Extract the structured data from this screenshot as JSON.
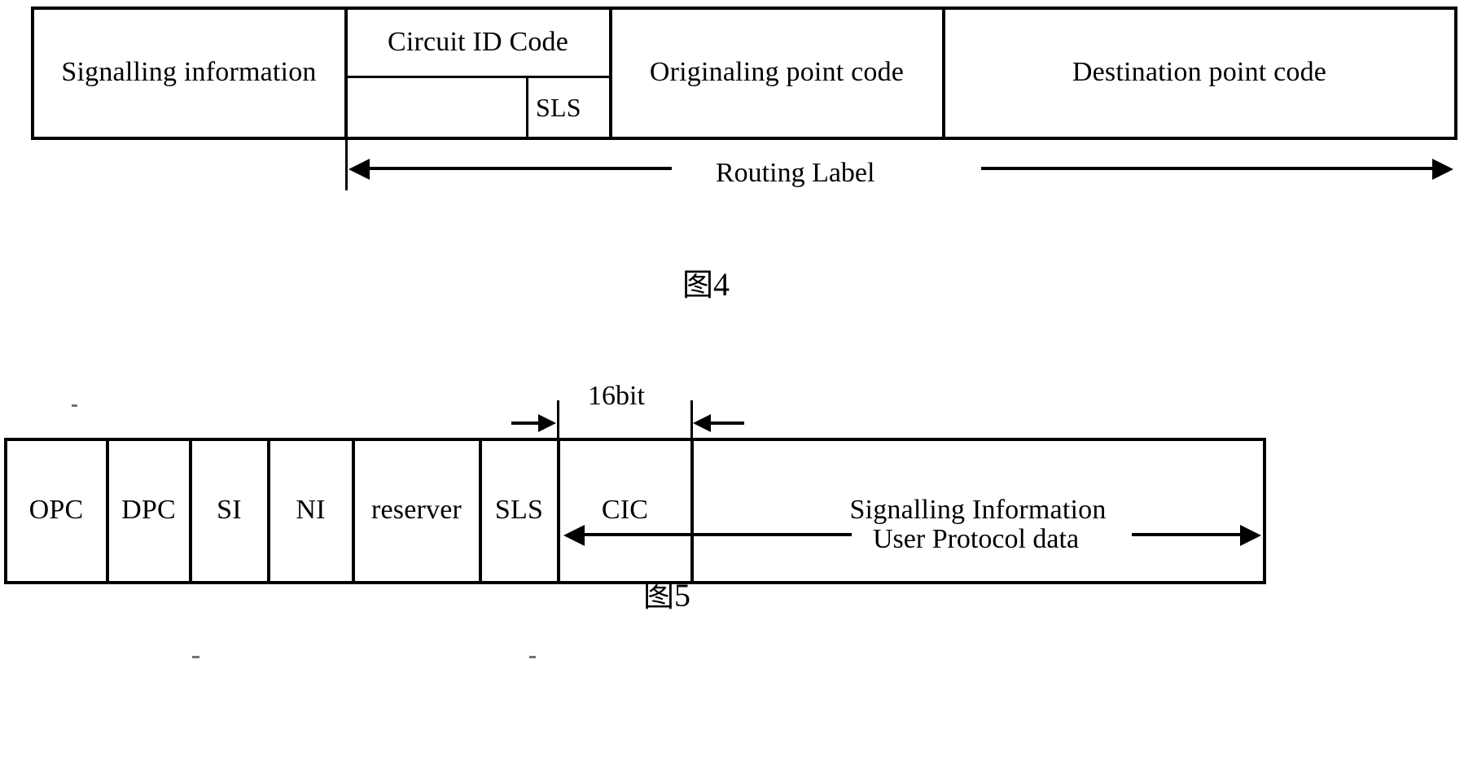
{
  "figure4": {
    "caption_cjk": "图",
    "caption_number": "4",
    "fields": {
      "signalling_information": "Signalling information",
      "circuit_id_code": "Circuit ID Code",
      "sls": "SLS",
      "originating_point_code": "Originaling point code",
      "destination_point_code": "Destination point code"
    },
    "span_label": "Routing Label"
  },
  "figure5": {
    "caption_cjk": "图",
    "caption_number": "5",
    "fields": [
      {
        "label": "OPC"
      },
      {
        "label": "DPC"
      },
      {
        "label": "SI"
      },
      {
        "label": "NI"
      },
      {
        "label": "reserver"
      },
      {
        "label": "SLS"
      },
      {
        "label": "CIC"
      },
      {
        "label": "Signalling Information"
      }
    ],
    "bit_width_label": "16bit",
    "span_label": "User Protocol data"
  },
  "colors": {
    "ink": "#000000",
    "page": "#ffffff"
  }
}
